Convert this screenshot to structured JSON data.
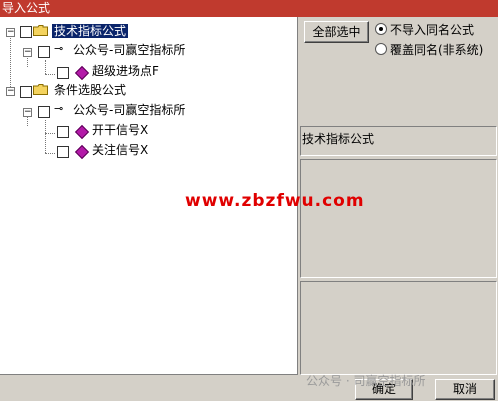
{
  "window": {
    "title": "导入公式"
  },
  "tree": {
    "nodes": [
      {
        "label": "技术指标公式",
        "type": "folder",
        "selected": true
      },
      {
        "label": "公众号-司赢空指标所",
        "type": "author"
      },
      {
        "label": "超级进场点F",
        "type": "formula"
      },
      {
        "label": "条件选股公式",
        "type": "folder"
      },
      {
        "label": "公众号-司赢空指标所",
        "type": "author"
      },
      {
        "label": "开干信号X",
        "type": "formula"
      },
      {
        "label": "关注信号X",
        "type": "formula"
      }
    ]
  },
  "controls": {
    "select_all": "全部选中",
    "radio_no_import": "不导入同名公式",
    "radio_overwrite": "覆盖同名(非系统)",
    "selected_radio": "radio_no_import"
  },
  "info": {
    "type_label": "技术指标公式"
  },
  "footer": {
    "ok": "确定",
    "cancel": "取消"
  },
  "overlays": {
    "watermark_site": "www.zbzfwu.com",
    "wechat_mark": "公众号 · 司赢空指标所"
  }
}
